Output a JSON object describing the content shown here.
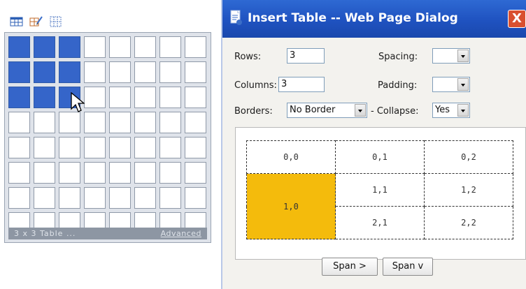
{
  "picker": {
    "rows_total": 8,
    "cols_total": 8,
    "selected_rows": 3,
    "selected_cols": 3,
    "status_text": "3 x 3 Table ...",
    "advanced_link": "Advanced",
    "toolbar_icons": [
      "table-icon",
      "edit-table-icon",
      "table-grid-icon"
    ]
  },
  "dialog": {
    "title": "Insert Table -- Web Page Dialog",
    "close_glyph": "X",
    "fields": {
      "rows_label": "Rows:",
      "rows_value": "3",
      "columns_label": "Columns:",
      "columns_value": "3",
      "spacing_label": "Spacing:",
      "spacing_value": "",
      "padding_label": "Padding:",
      "padding_value": "",
      "borders_label": "Borders:",
      "borders_value": "No Border",
      "collapse_label": "- Collapse:",
      "collapse_value": "Yes"
    },
    "preview": {
      "cells": {
        "r0c0": "0,0",
        "r0c1": "0,1",
        "r0c2": "0,2",
        "r1c0": "1,0",
        "r1c1": "1,1",
        "r1c2": "1,2",
        "r2c1": "2,1",
        "r2c2": "2,2"
      },
      "highlight_color": "#f4bb0c"
    },
    "buttons": {
      "span_right": "Span >",
      "span_down": "Span v"
    }
  },
  "colors": {
    "selected_cell": "#3565c9",
    "titlebar": "#1f52c0"
  }
}
